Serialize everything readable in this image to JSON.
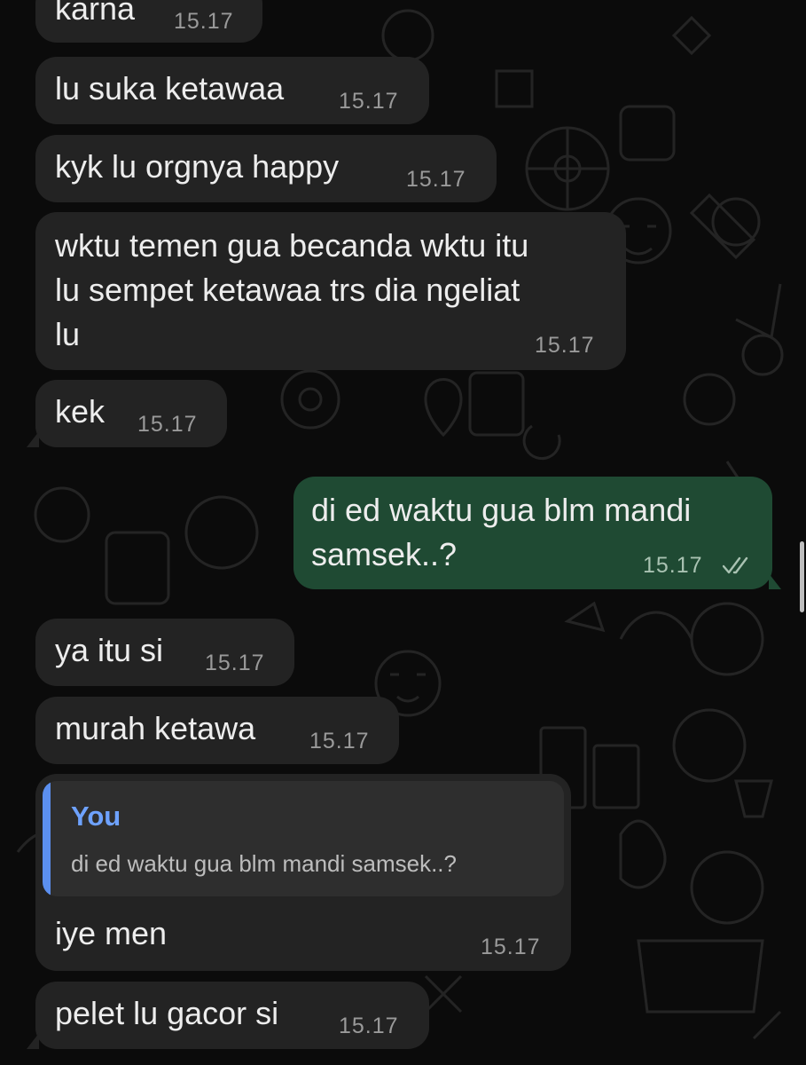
{
  "chat": {
    "messages": [
      {
        "id": "m1",
        "direction": "in",
        "text_lines": [
          "karna"
        ],
        "time": "15.17"
      },
      {
        "id": "m2",
        "direction": "in",
        "text_lines": [
          "lu suka ketawaa"
        ],
        "time": "15.17"
      },
      {
        "id": "m3",
        "direction": "in",
        "text_lines": [
          "kyk lu orgnya happy"
        ],
        "time": "15.17"
      },
      {
        "id": "m4",
        "direction": "in",
        "text_lines": [
          "wktu temen gua becanda wktu itu",
          "lu sempet ketawaa trs dia ngeliat",
          "lu"
        ],
        "time": "15.17"
      },
      {
        "id": "m5",
        "direction": "in",
        "text_lines": [
          "kek"
        ],
        "time": "15.17"
      },
      {
        "id": "m6",
        "direction": "out",
        "text_lines": [
          "di ed waktu gua blm mandi",
          "samsek..?"
        ],
        "time": "15.17",
        "status": "read"
      },
      {
        "id": "m7",
        "direction": "in",
        "text_lines": [
          "ya itu si"
        ],
        "time": "15.17"
      },
      {
        "id": "m8",
        "direction": "in",
        "text_lines": [
          "murah ketawa"
        ],
        "time": "15.17"
      },
      {
        "id": "m9",
        "direction": "in",
        "reply_to": {
          "author": "You",
          "text": "di ed waktu gua blm mandi samsek..?"
        },
        "text_lines": [
          "iye men"
        ],
        "time": "15.17"
      },
      {
        "id": "m10",
        "direction": "in",
        "text_lines": [
          "pelet lu gacor si"
        ],
        "time": "15.17"
      }
    ]
  },
  "icons": {
    "read_receipt": "double-check-icon"
  },
  "colors": {
    "background": "#0b0b0b",
    "incoming_bubble": "#232323",
    "outgoing_bubble": "#1f4a33",
    "reply_accent": "#5b8fef",
    "timestamp": "#9a9a9a"
  }
}
